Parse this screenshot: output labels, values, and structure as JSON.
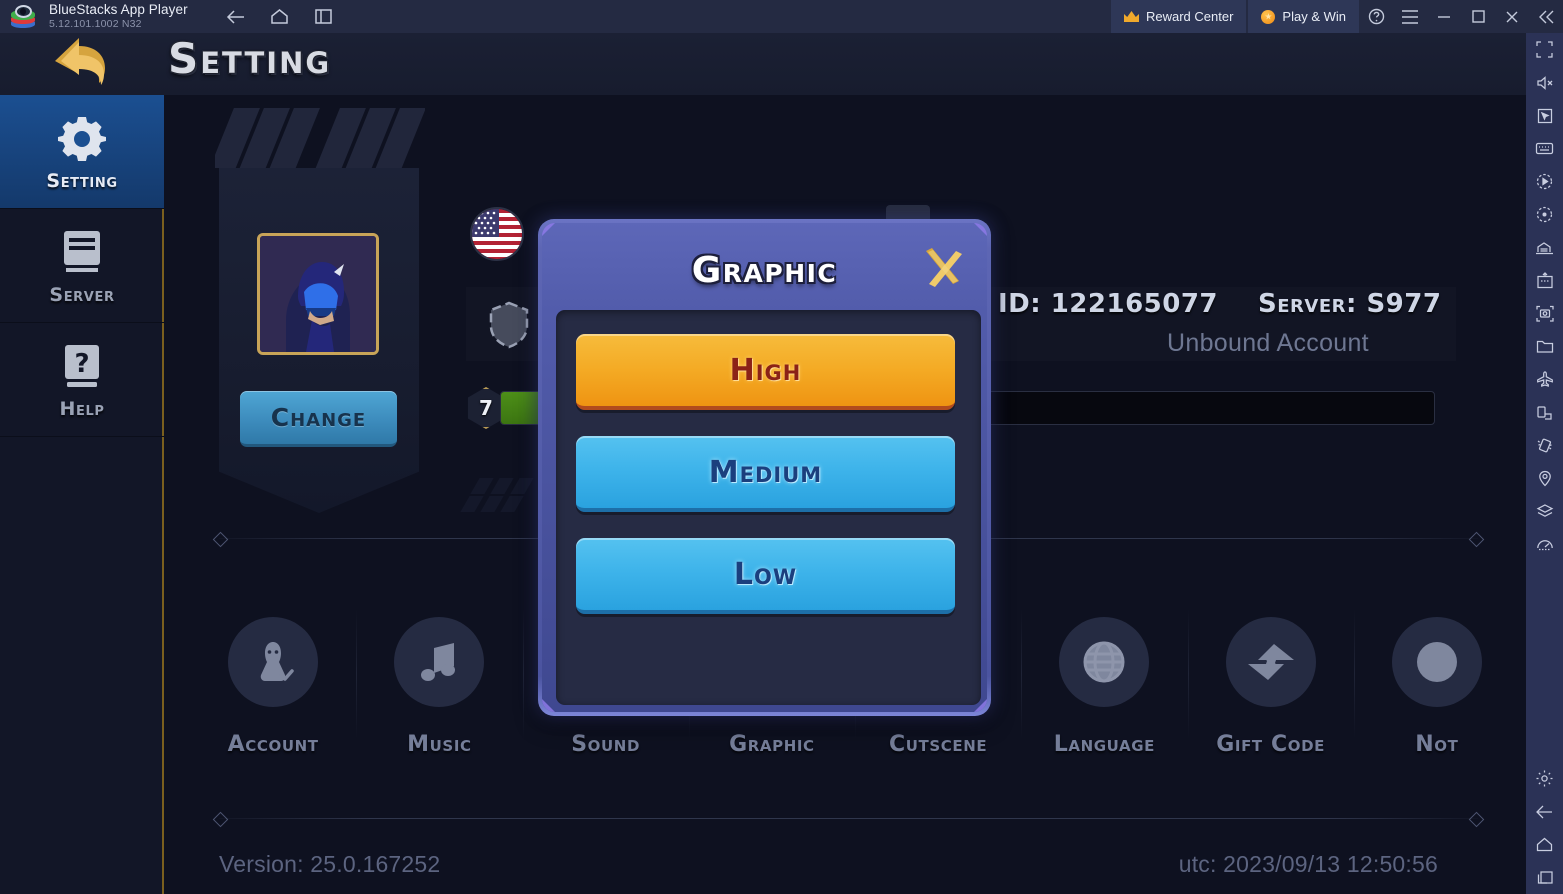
{
  "titlebar": {
    "app_name": "BlueStacks App Player",
    "version": "5.12.101.1002  N32",
    "nav": [
      {
        "name": "back",
        "label": "Back"
      },
      {
        "name": "home",
        "label": "Home"
      },
      {
        "name": "multi-instance",
        "label": "Multi-instance"
      }
    ],
    "reward_center": "Reward Center",
    "play_and_win": "Play & Win",
    "help_tooltip": "Help",
    "menu_tooltip": "Menu",
    "minimize_tooltip": "Minimize",
    "maximize_tooltip": "Maximize",
    "close_tooltip": "Close",
    "collapse_tooltip": "Collapse"
  },
  "rail": {
    "items": [
      "fullscreen-icon",
      "mute-icon",
      "cursor-icon",
      "keyboard-icon",
      "macro-play-icon",
      "macro-record-icon",
      "multi-instance-manager-icon",
      "install-apk-icon",
      "screenshot-icon",
      "media-folder-icon",
      "airplane-icon",
      "rotate-icon",
      "shake-icon",
      "location-icon",
      "layers-icon",
      "performance-icon"
    ],
    "bottom_items": [
      "gear-icon",
      "back-icon",
      "home-icon",
      "recents-icon"
    ]
  },
  "game": {
    "page_title": "Setting",
    "back_button": "Back",
    "sidebar": [
      {
        "label": "Setting",
        "icon": "gear-icon",
        "active": true
      },
      {
        "label": "Server",
        "icon": "server-icon",
        "active": false
      },
      {
        "label": "Help",
        "icon": "help-book-icon",
        "active": false
      }
    ],
    "profile": {
      "change_button": "Change",
      "avatar": "hooded-rogue-avatar",
      "flag": "us-flag-icon",
      "guild_icon": "shield-icon",
      "level": "7",
      "xp_percent": 5
    },
    "account": {
      "id_label": "ID: 122165077",
      "server_label": "Server: S977",
      "bind_status": "Unbound Account"
    },
    "icon_row": [
      {
        "label": "Account",
        "icon": "account-icon"
      },
      {
        "label": "Music",
        "icon": "music-note-icon"
      },
      {
        "label": "Sound",
        "icon": "speaker-icon"
      },
      {
        "label": "Graphic",
        "icon": "graphic-icon"
      },
      {
        "label": "Cutscene",
        "icon": "cutscene-icon"
      },
      {
        "label": "Language",
        "icon": "globe-icon"
      },
      {
        "label": "Gift Code",
        "icon": "gift-code-icon"
      },
      {
        "label": "Not",
        "icon": "notice-icon"
      }
    ],
    "footer": {
      "version": "Version: 25.0.167252",
      "utc": "utc: 2023/09/13 12:50:56"
    }
  },
  "modal": {
    "title": "Graphic",
    "close_label": "Close",
    "options": [
      {
        "label": "High",
        "selected": true
      },
      {
        "label": "Medium",
        "selected": false
      },
      {
        "label": "Low",
        "selected": false
      }
    ]
  },
  "colors": {
    "titlebar_bg": "#242a42",
    "rail_bg": "#2b3256",
    "game_bg": "#0e1120",
    "accent_gold": "#f4ab25",
    "accent_blue": "#3db3ea",
    "modal_border": "#5d66b4",
    "sidebar_active": "#1b4f91",
    "xp_green": "#4d8f18"
  }
}
